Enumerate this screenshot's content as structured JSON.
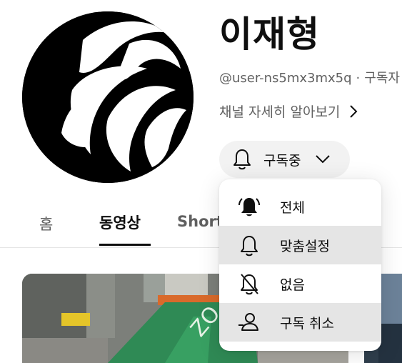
{
  "channel": {
    "name": "이재형",
    "handle": "@user-ns5mx3mx5q",
    "separator": "·",
    "subscribers_partial": "구독자",
    "more_label": "채널 자세히 알아보기"
  },
  "subscribe_button": {
    "label": "구독중",
    "icon": "bell-icon"
  },
  "tabs": [
    {
      "label": "홈",
      "active": false
    },
    {
      "label": "동영상",
      "active": true
    },
    {
      "label": "Shorts",
      "active": false
    }
  ],
  "notification_menu": {
    "items": [
      {
        "label": "전체",
        "icon": "bell-ringing-icon",
        "highlighted": false
      },
      {
        "label": "맞춤설정",
        "icon": "bell-outline-icon",
        "highlighted": true
      },
      {
        "label": "없음",
        "icon": "bell-off-icon",
        "highlighted": false
      },
      {
        "label": "구독 취소",
        "icon": "person-minus-icon",
        "highlighted": true
      }
    ]
  },
  "colors": {
    "text_primary": "#0f0f0f",
    "text_secondary": "#606060",
    "button_bg": "#f2f2f2",
    "menu_highlight": "#e5e5e5"
  }
}
